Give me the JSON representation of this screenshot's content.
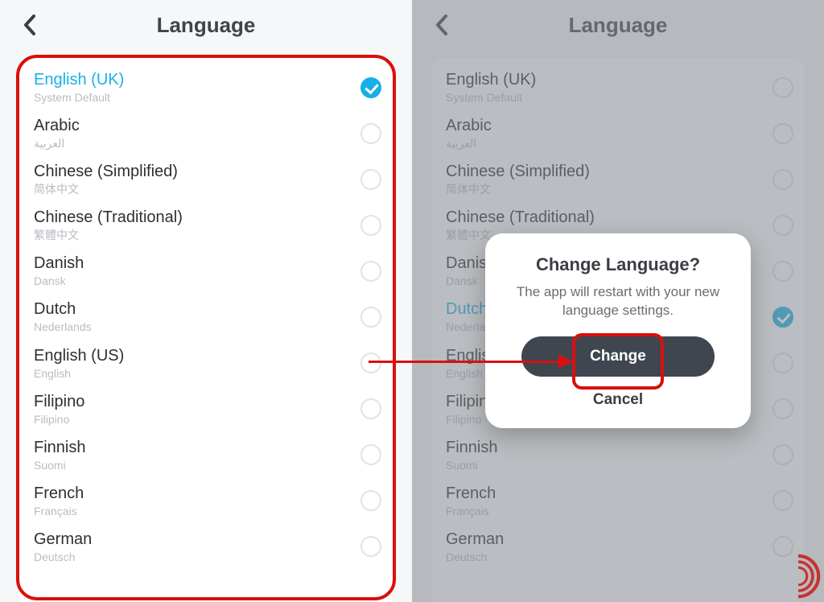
{
  "left": {
    "title": "Language",
    "selected_index": 0,
    "items": [
      {
        "name": "English (UK)",
        "sub": "System Default"
      },
      {
        "name": "Arabic",
        "sub": "العربية"
      },
      {
        "name": "Chinese (Simplified)",
        "sub": "简体中文"
      },
      {
        "name": "Chinese (Traditional)",
        "sub": "繁體中文"
      },
      {
        "name": "Danish",
        "sub": "Dansk"
      },
      {
        "name": "Dutch",
        "sub": "Nederlands"
      },
      {
        "name": "English (US)",
        "sub": "English"
      },
      {
        "name": "Filipino",
        "sub": "Filipino"
      },
      {
        "name": "Finnish",
        "sub": "Suomi"
      },
      {
        "name": "French",
        "sub": "Français"
      },
      {
        "name": "German",
        "sub": "Deutsch"
      }
    ]
  },
  "right": {
    "title": "Language",
    "selected_index": 5,
    "items": [
      {
        "name": "English (UK)",
        "sub": "System Default"
      },
      {
        "name": "Arabic",
        "sub": "العربية"
      },
      {
        "name": "Chinese (Simplified)",
        "sub": "简体中文"
      },
      {
        "name": "Chinese (Traditional)",
        "sub": "繁體中文"
      },
      {
        "name": "Danish",
        "sub": "Dansk"
      },
      {
        "name": "Dutch",
        "sub": "Nederlands"
      },
      {
        "name": "English (US)",
        "sub": "English"
      },
      {
        "name": "Filipino",
        "sub": "Filipino"
      },
      {
        "name": "Finnish",
        "sub": "Suomi"
      },
      {
        "name": "French",
        "sub": "Français"
      },
      {
        "name": "German",
        "sub": "Deutsch"
      }
    ]
  },
  "dialog": {
    "title": "Change Language?",
    "body": "The app will restart with your new language settings.",
    "change": "Change",
    "cancel": "Cancel"
  }
}
